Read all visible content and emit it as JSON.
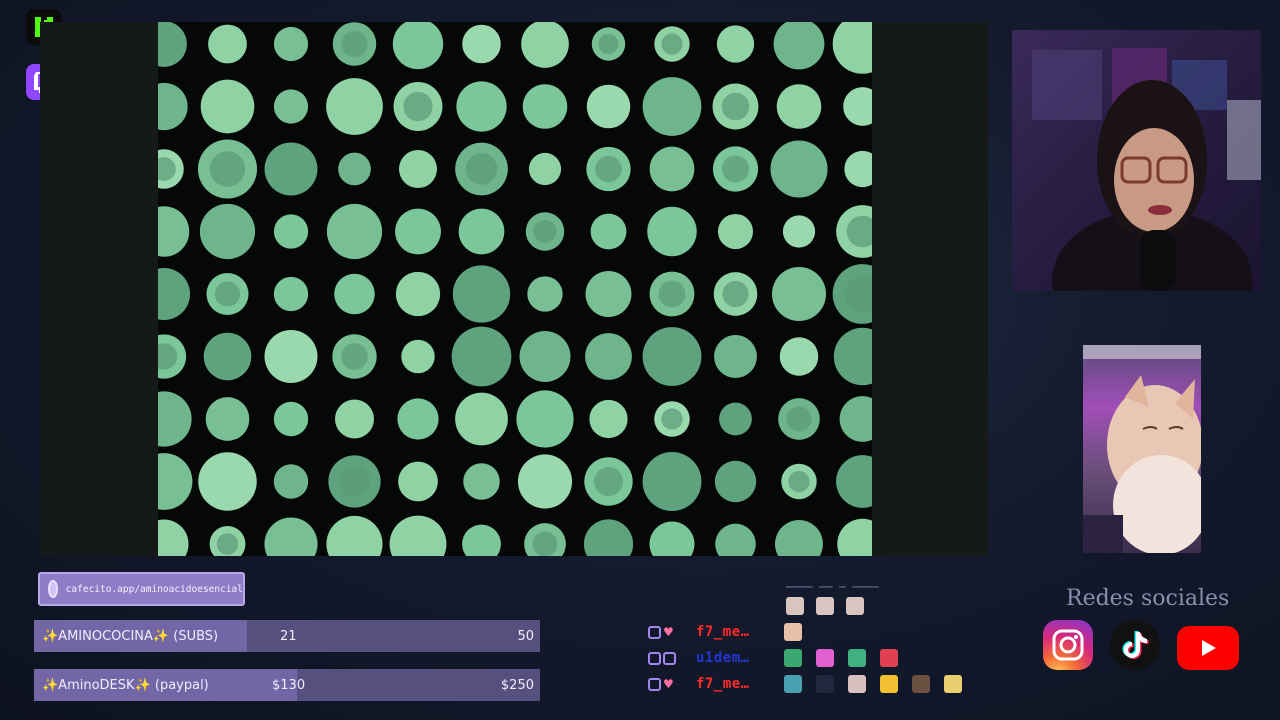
{
  "badges": [
    {
      "name": "kick-logo",
      "glyph": "K",
      "color": "#53fc18"
    },
    {
      "name": "twitch-logo",
      "color": "#9146ff"
    }
  ],
  "donation": {
    "url": "cafecito.app/aminoacidoesencial"
  },
  "goals": [
    {
      "label": "✨AMINOCOCINA✨ (SUBS)",
      "current": "21",
      "target": "50",
      "progress": 0.42
    },
    {
      "label": "✨AminoDESK✨ (paypal)",
      "current": "$130",
      "target": "$250",
      "progress": 0.52
    }
  ],
  "chat": [
    {
      "name": "f7_me…",
      "color": "#ff2a2a",
      "icon2": "heart"
    },
    {
      "name": "u1dem…",
      "color": "#2236d4",
      "icon2": "badge"
    },
    {
      "name": "f7_me…",
      "color": "#ff2a2a",
      "icon2": "heart"
    }
  ],
  "socials": {
    "title": "Redes sociales",
    "items": [
      "instagram-icon",
      "tiktok-icon",
      "youtube-icon"
    ]
  }
}
